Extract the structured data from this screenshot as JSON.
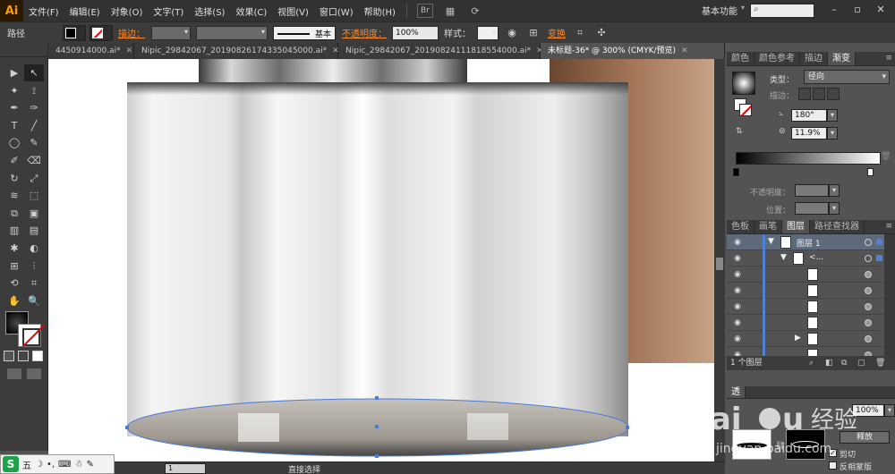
{
  "app": {
    "logo": "Ai",
    "workspace": "基本功能",
    "workspace_arrow": "▾",
    "search_icon": "search-icon"
  },
  "menu": [
    "文件(F)",
    "编辑(E)",
    "对象(O)",
    "文字(T)",
    "选择(S)",
    "效果(C)",
    "视图(V)",
    "窗口(W)",
    "帮助(H)"
  ],
  "menu_icons": {
    "bridge": "Br",
    "arrange": "▦",
    "gpu": "⟳"
  },
  "window_controls": {
    "minimize": "–",
    "restore": "▫",
    "close": "✕"
  },
  "control_bar": {
    "selection_label": "路径",
    "stroke_label": "描边：",
    "stroke_profile": "基本",
    "opacity_label": "不透明度：",
    "opacity_value": "100%",
    "style_label": "样式：",
    "transform_label": "变换"
  },
  "tabs": [
    {
      "label": "4450914000.ai*",
      "active": false
    },
    {
      "label": "Nipic_29842067_20190826174335045000.ai*",
      "active": false
    },
    {
      "label": "Nipic_29842067_20190824111818554000.ai*",
      "active": false
    },
    {
      "label": "未标题-36* @ 300% (CMYK/预览)",
      "active": true
    }
  ],
  "tab_close": "✕",
  "tools": [
    "▶",
    "↖",
    "✦",
    "⟟",
    "✒",
    "✑",
    "T",
    "╱",
    "◯",
    "✎",
    "✐",
    "⌫",
    "↻",
    "⤢",
    "≋",
    "⬚",
    "⧉",
    "▣",
    "▥",
    "▤",
    "✱",
    "◐",
    "⊞",
    "⫶",
    "⟲",
    "⌗",
    "✋",
    "🔍"
  ],
  "status": {
    "zoom": "1",
    "tool": "直接选择"
  },
  "ime": {
    "logo": "S",
    "mode": "五",
    "moon": "☽",
    "punct": "•,",
    "keyboard": "⌨",
    "skin": "☃",
    "wrench": "✎"
  },
  "gradient_panel": {
    "tabs": [
      "颜色",
      "颜色参考",
      "描边",
      "渐变"
    ],
    "menu_icon": "≡",
    "type_label": "类型：",
    "type_value": "径向",
    "stroke_label": "描边：",
    "angle_value": "180°",
    "aspect_value": "11.9%",
    "opacity_label": "不透明度：",
    "position_label": "位置：",
    "trash_icon": "trash-icon"
  },
  "layers_panel": {
    "tabs": [
      "色板",
      "画笔",
      "图层",
      "路径查找器"
    ],
    "layer_name": "图层 1",
    "group_name": "<...",
    "footer": "1 个图层"
  },
  "transparency_panel": {
    "release_label": "释放",
    "clip_label": "剪切",
    "clip_checked": "✓",
    "invert_label": "反相蒙版",
    "opacity_value": "100%",
    "mask_label": "透"
  },
  "colors": {
    "accent_orange": "#ff8a28",
    "layer_blue": "#4f7fd6",
    "bg_dark": "#323232",
    "panel": "#535353"
  }
}
